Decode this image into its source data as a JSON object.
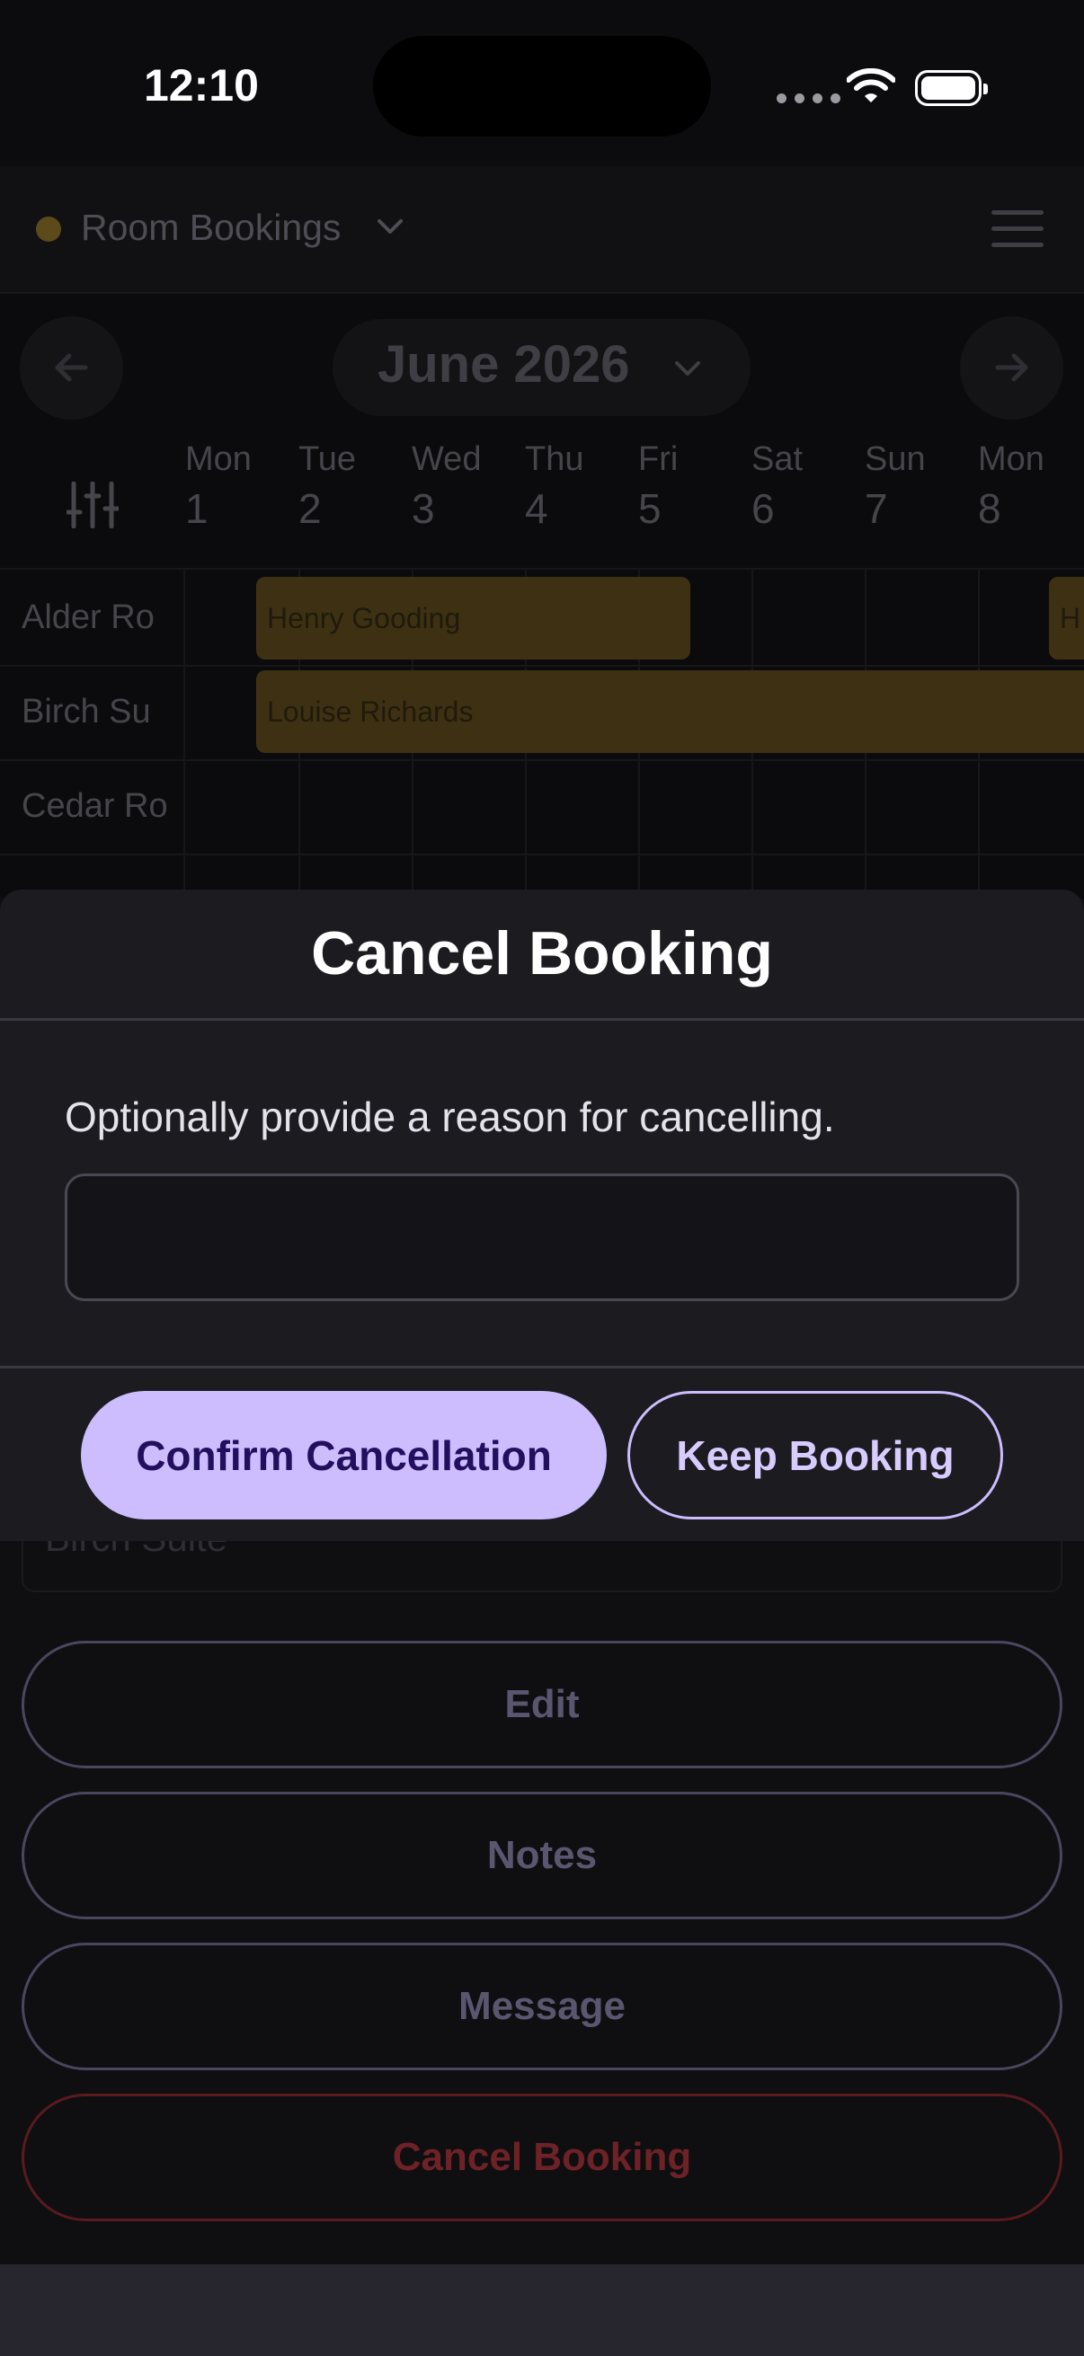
{
  "status_bar": {
    "time": "12:10"
  },
  "header": {
    "title": "Room Bookings"
  },
  "calendar": {
    "month": "June 2026",
    "days": [
      {
        "name": "Mon",
        "num": "1"
      },
      {
        "name": "Tue",
        "num": "2"
      },
      {
        "name": "Wed",
        "num": "3"
      },
      {
        "name": "Thu",
        "num": "4"
      },
      {
        "name": "Fri",
        "num": "5"
      },
      {
        "name": "Sat",
        "num": "6"
      },
      {
        "name": "Sun",
        "num": "7"
      },
      {
        "name": "Mon",
        "num": "8"
      }
    ],
    "rooms": [
      "Alder Ro",
      "Birch Su",
      "Cedar Ro"
    ],
    "bookings": [
      {
        "guest": "Henry Gooding"
      },
      {
        "guest": "H"
      },
      {
        "guest": "Louise Richards"
      }
    ]
  },
  "detail": {
    "room_field": "Birch Suite",
    "edit_label": "Edit",
    "notes_label": "Notes",
    "message_label": "Message",
    "cancel_label": "Cancel Booking"
  },
  "sheet": {
    "title": "Cancel Booking",
    "prompt": "Optionally provide a reason for cancelling.",
    "reason_value": "",
    "confirm_label": "Confirm Cancellation",
    "keep_label": "Keep Booking"
  },
  "colors": {
    "accent": "#cdbdff",
    "accent_text": "#21105e",
    "booking": "#3e3113",
    "danger": "#6e2226"
  }
}
